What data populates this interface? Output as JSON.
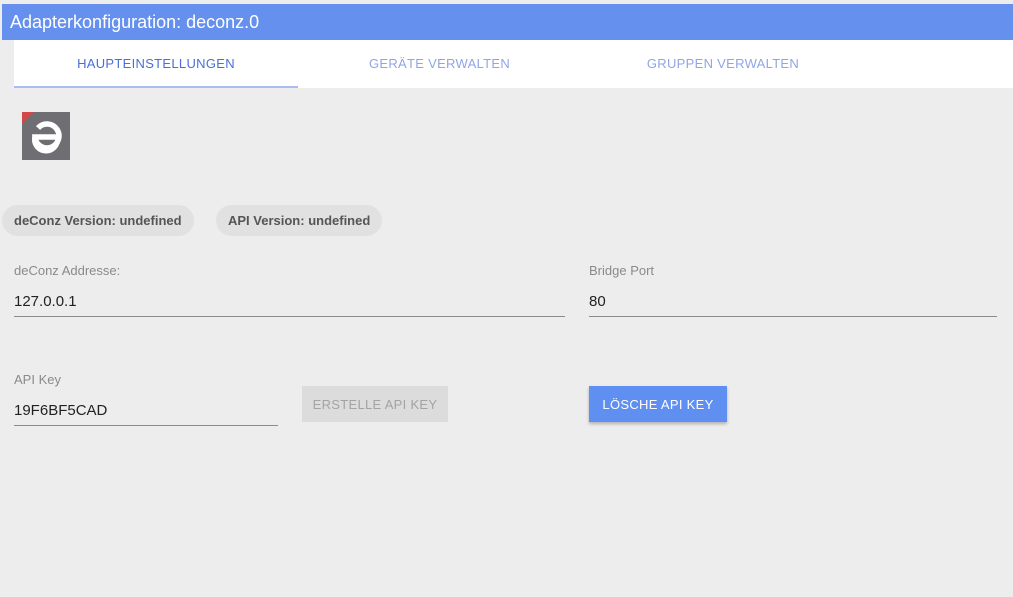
{
  "window": {
    "title": "Adapterkonfiguration: deconz.0"
  },
  "tabs": [
    {
      "label": "HAUPTEINSTELLUNGEN",
      "active": true
    },
    {
      "label": "GERÄTE VERWALTEN",
      "active": false
    },
    {
      "label": "GRUPPEN VERWALTEN",
      "active": false
    }
  ],
  "logo": {
    "icon": "deconz-logo-icon",
    "background": "#6e6e73",
    "accent": "#d04848"
  },
  "info_chips": [
    {
      "label": "deConz Version: undefined"
    },
    {
      "label": "API Version: undefined"
    }
  ],
  "fields": {
    "address": {
      "label": "deConz Addresse:",
      "value": "127.0.0.1"
    },
    "port": {
      "label": "Bridge Port",
      "value": "80"
    },
    "api_key": {
      "label": "API Key",
      "value": "19F6BF5CAD"
    }
  },
  "buttons": {
    "create_key": {
      "label": "ERSTELLE API KEY",
      "disabled": true
    },
    "delete_key": {
      "label": "LÖSCHE API KEY",
      "disabled": false
    }
  },
  "colors": {
    "header": "#6590ee",
    "primary_button": "#5f8ff0",
    "active_tab": "#4a6fd6",
    "inactive_tab": "#8fa6e6"
  }
}
